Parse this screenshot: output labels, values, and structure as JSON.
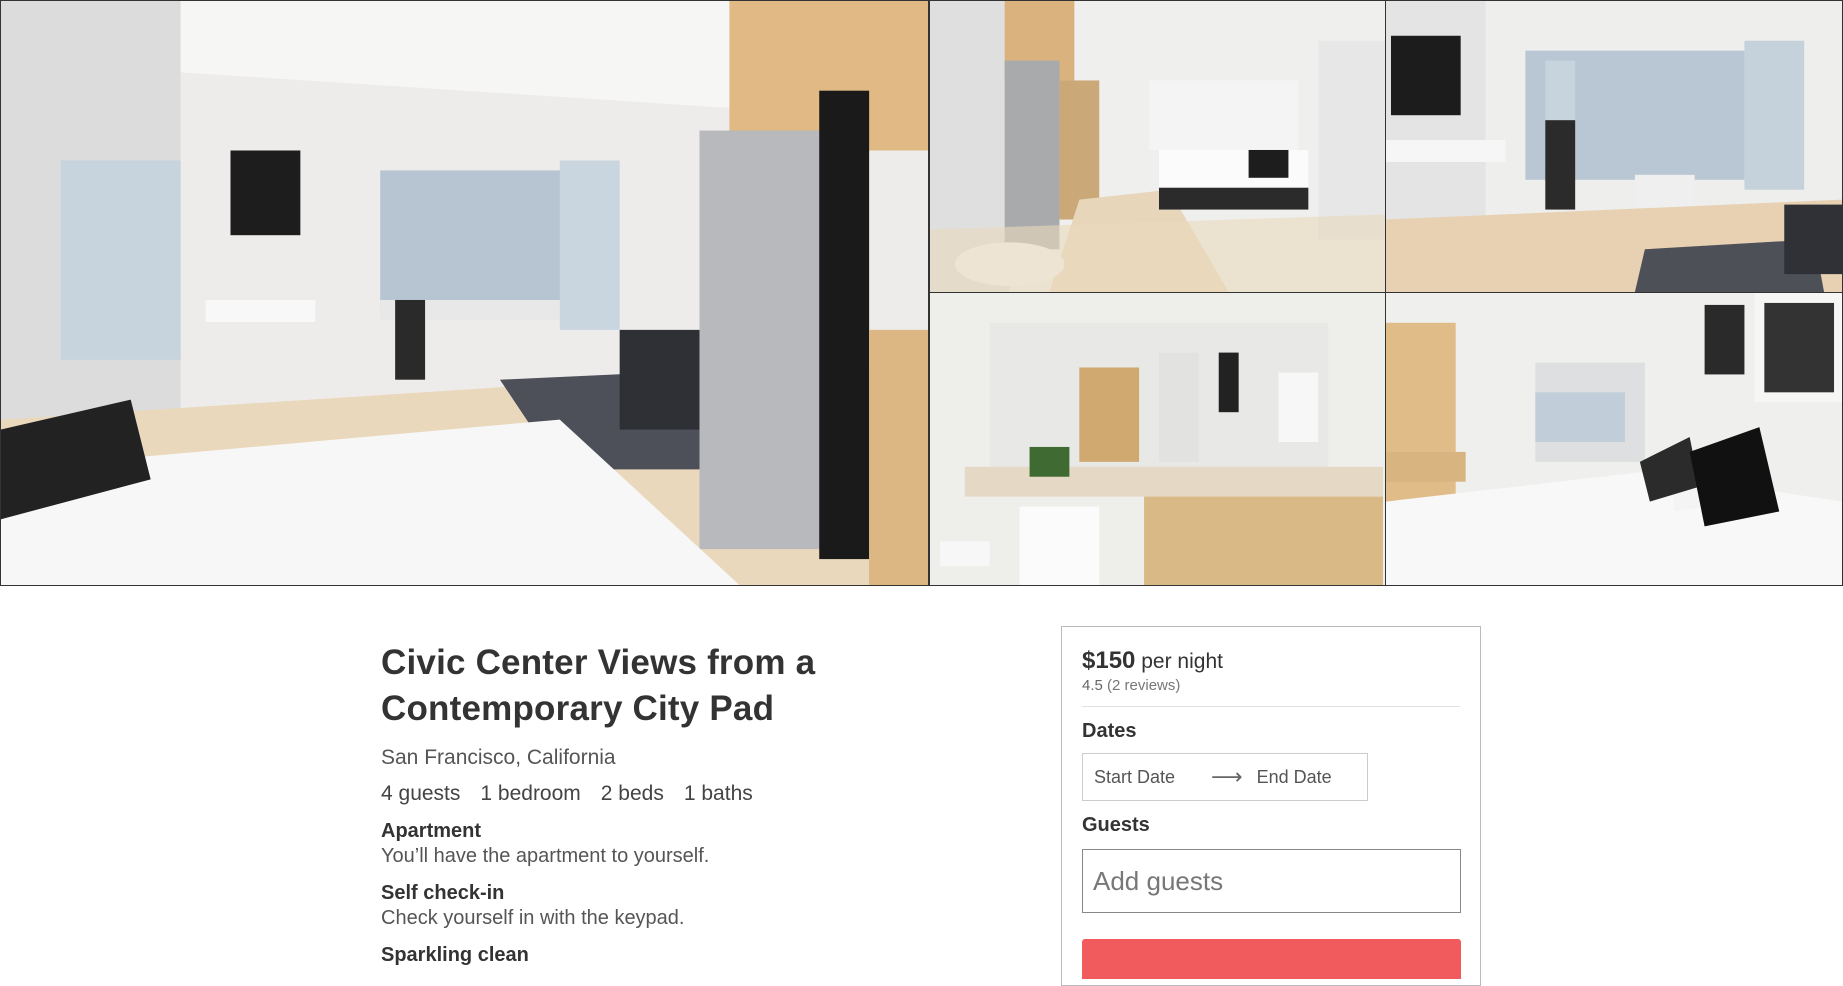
{
  "gallery": {
    "photos": [
      {
        "alt": "Living area with bed, kitchen and window view"
      },
      {
        "alt": "Kitchen and bedroom view"
      },
      {
        "alt": "Window dining area"
      },
      {
        "alt": "Bathroom vanity"
      },
      {
        "alt": "Bed with black pillows"
      }
    ]
  },
  "listing": {
    "title": "Civic Center Views from a Contemporary City Pad",
    "location": "San Francisco, California",
    "specs": {
      "guests": "4 guests",
      "bedrooms": "1 bedroom",
      "beds": "2 beds",
      "baths": "1 baths"
    },
    "features": [
      {
        "title": "Apartment",
        "desc": "You’ll have the apartment to yourself."
      },
      {
        "title": "Self check-in",
        "desc": "Check yourself in with the keypad."
      },
      {
        "title": "Sparkling clean",
        "desc": ""
      }
    ]
  },
  "booking": {
    "price": "$150",
    "per_night": "per night",
    "rating": "4.5",
    "reviews": "(2 reviews)",
    "dates_label": "Dates",
    "start_date_placeholder": "Start Date",
    "end_date_placeholder": "End Date",
    "guests_label": "Guests",
    "guests_placeholder": "Add guests",
    "reserve_label": "",
    "accent_color": "#f15b5d"
  }
}
